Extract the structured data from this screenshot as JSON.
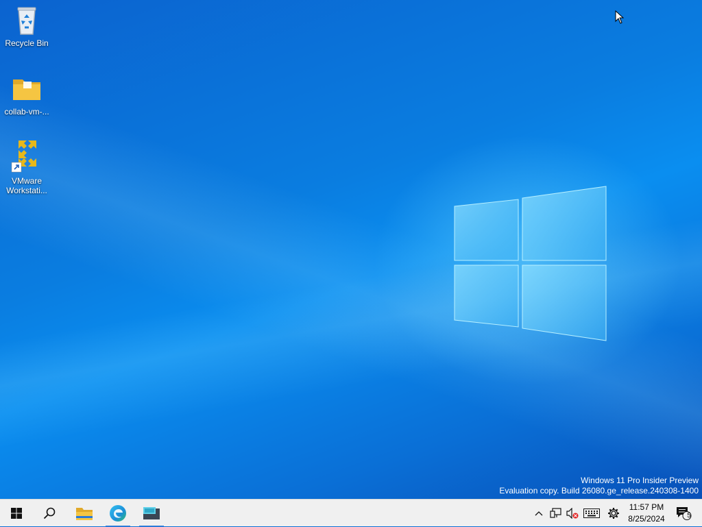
{
  "desktop": {
    "icons": [
      {
        "label": "Recycle Bin"
      },
      {
        "label": "collab-vm-..."
      },
      {
        "label": "VMware Workstati..."
      }
    ],
    "watermark": {
      "line1": "Windows 11 Pro Insider Preview",
      "line2": "Evaluation copy. Build 26080.ge_release.240308-1400"
    }
  },
  "taskbar": {
    "buttons": [
      "start-icon",
      "search-icon",
      "file-explorer-icon",
      "edge-icon",
      "vmware-app-icon"
    ],
    "active_buttons": [
      "edge-icon",
      "vmware-app-icon"
    ],
    "tray_icons": [
      "chevron-up-icon",
      "network-icon",
      "volume-muted-icon",
      "keyboard-icon",
      "settings-icon"
    ],
    "clock": {
      "time": "11:57 PM",
      "date": "8/25/2024"
    },
    "notifications": {
      "count": "5"
    }
  },
  "colors": {
    "accent": "#2a7ad8",
    "taskbar_bg": "#f0f0f0",
    "wallpaper": "#0a6fd6",
    "folder": "#f5c542",
    "vmware": "#e8b81a"
  }
}
